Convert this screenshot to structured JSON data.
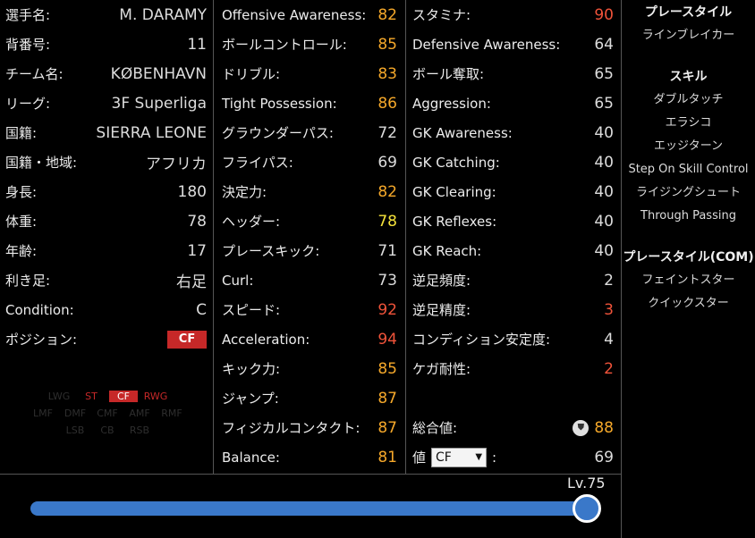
{
  "profile": {
    "rows": [
      {
        "label": "選手名:",
        "value": "M. DARAMY"
      },
      {
        "label": "背番号:",
        "value": "11"
      },
      {
        "label": "チーム名:",
        "value": "KØBENHAVN"
      },
      {
        "label": "リーグ:",
        "value": "3F Superliga"
      },
      {
        "label": "国籍:",
        "value": "SIERRA LEONE"
      },
      {
        "label": "国籍・地域:",
        "value": "アフリカ"
      },
      {
        "label": "身長:",
        "value": "180"
      },
      {
        "label": "体重:",
        "value": "78"
      },
      {
        "label": "年齢:",
        "value": "17"
      },
      {
        "label": "利き足:",
        "value": "右足"
      },
      {
        "label": "Condition:",
        "value": "C"
      }
    ],
    "position_label": "ポジション:",
    "position_value": "CF",
    "position_map": {
      "row1": [
        "LWG",
        "ST",
        "CF",
        "RWG"
      ],
      "row2": [
        "LMF",
        "DMF",
        "CMF",
        "AMF",
        "RMF"
      ],
      "row3": [
        "LSB",
        "CB",
        "RSB"
      ]
    }
  },
  "stats_a": [
    {
      "label": "Offensive Awareness:",
      "value": "82",
      "color": "#f5a82a"
    },
    {
      "label": "ボールコントロール:",
      "value": "85",
      "color": "#f5a82a"
    },
    {
      "label": "ドリブル:",
      "value": "83",
      "color": "#f5a82a"
    },
    {
      "label": "Tight Possession:",
      "value": "86",
      "color": "#f5a82a"
    },
    {
      "label": "グラウンダーパス:",
      "value": "72",
      "color": "#dcdcdc"
    },
    {
      "label": "フライパス:",
      "value": "69",
      "color": "#dcdcdc"
    },
    {
      "label": "決定力:",
      "value": "82",
      "color": "#f5a82a"
    },
    {
      "label": "ヘッダー:",
      "value": "78",
      "color": "#f5e23a"
    },
    {
      "label": "プレースキック:",
      "value": "71",
      "color": "#dcdcdc"
    },
    {
      "label": "Curl:",
      "value": "73",
      "color": "#dcdcdc"
    },
    {
      "label": "スピード:",
      "value": "92",
      "color": "#f0533a"
    },
    {
      "label": "Acceleration:",
      "value": "94",
      "color": "#f0533a"
    },
    {
      "label": "キック力:",
      "value": "85",
      "color": "#f5a82a"
    },
    {
      "label": "ジャンプ:",
      "value": "87",
      "color": "#f5a82a"
    },
    {
      "label": "フィジカルコンタクト:",
      "value": "87",
      "color": "#f5a82a"
    },
    {
      "label": "Balance:",
      "value": "81",
      "color": "#f5a82a"
    }
  ],
  "stats_b": [
    {
      "label": "スタミナ:",
      "value": "90",
      "color": "#f0533a"
    },
    {
      "label": "Defensive Awareness:",
      "value": "64",
      "color": "#dcdcdc"
    },
    {
      "label": "ボール奪取:",
      "value": "65",
      "color": "#dcdcdc"
    },
    {
      "label": "Aggression:",
      "value": "65",
      "color": "#dcdcdc"
    },
    {
      "label": "GK Awareness:",
      "value": "40",
      "color": "#dcdcdc"
    },
    {
      "label": "GK Catching:",
      "value": "40",
      "color": "#dcdcdc"
    },
    {
      "label": "GK Clearing:",
      "value": "40",
      "color": "#dcdcdc"
    },
    {
      "label": "GK Reflexes:",
      "value": "40",
      "color": "#dcdcdc"
    },
    {
      "label": "GK Reach:",
      "value": "40",
      "color": "#dcdcdc"
    },
    {
      "label": "逆足頻度:",
      "value": "2",
      "color": "#dcdcdc"
    },
    {
      "label": "逆足精度:",
      "value": "3",
      "color": "#f0533a"
    },
    {
      "label": "コンディション安定度:",
      "value": "4",
      "color": "#dcdcdc"
    },
    {
      "label": "ケガ耐性:",
      "value": "2",
      "color": "#f0533a"
    }
  ],
  "overall": {
    "label": "総合値:",
    "value": "88"
  },
  "rated": {
    "label": "値",
    "select": "CF",
    "colon": ":",
    "value": "69"
  },
  "sidebar": {
    "playstyle_head": "プレースタイル",
    "playstyle": "ラインブレイカー",
    "skills_head": "スキル",
    "skills": [
      "ダブルタッチ",
      "エラシコ",
      "エッジターン",
      "Step On Skill Control",
      "ライジングシュート",
      "Through Passing"
    ],
    "com_head": "プレースタイル(COM)",
    "com": [
      "フェイントスター",
      "クイックスター"
    ]
  },
  "level": {
    "label": "Lv.75",
    "fraction": 1.0
  }
}
